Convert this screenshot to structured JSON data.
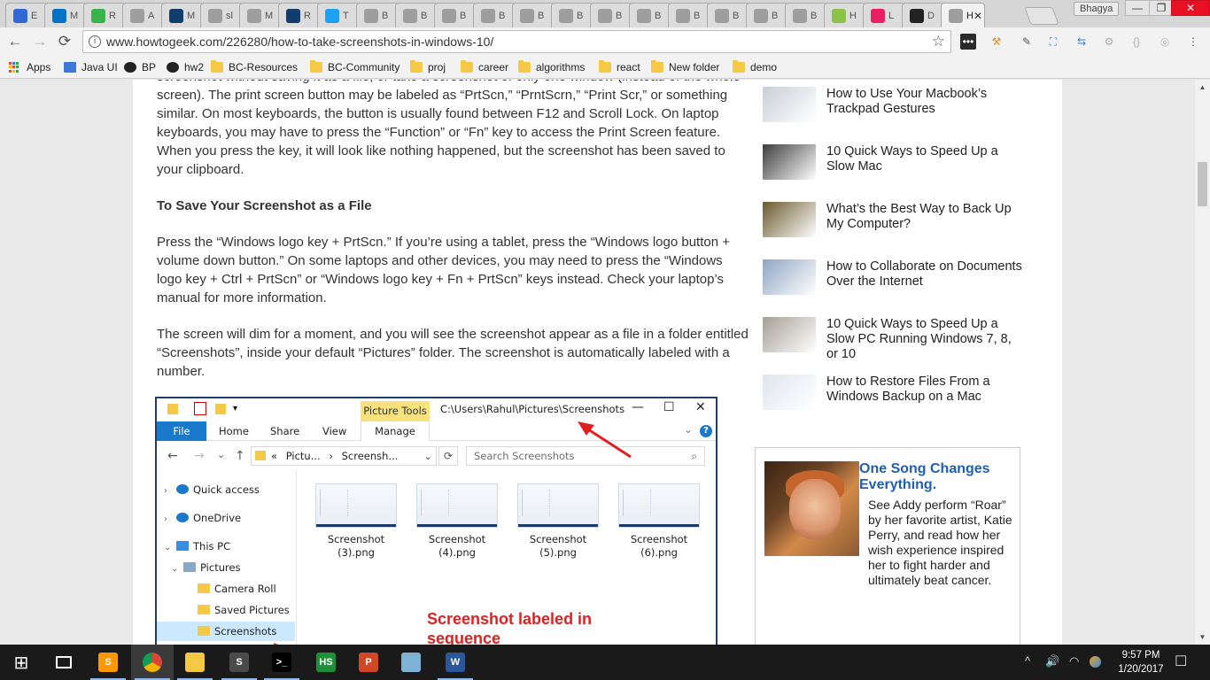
{
  "browser": {
    "tabs": [
      {
        "title": "E",
        "color": "#3367d6"
      },
      {
        "title": "M",
        "color": "#0072c6"
      },
      {
        "title": "R",
        "color": "#3ab44a"
      },
      {
        "title": "A",
        "color": "#9e9e9e"
      },
      {
        "title": "M",
        "color": "#123e6e"
      },
      {
        "title": "sl",
        "color": "#9e9e9e"
      },
      {
        "title": "M",
        "color": "#9e9e9e"
      },
      {
        "title": "R",
        "color": "#123e6e"
      },
      {
        "title": "T",
        "color": "#1da1f2"
      },
      {
        "title": "B",
        "color": "#9e9e9e"
      },
      {
        "title": "B",
        "color": "#9e9e9e"
      },
      {
        "title": "B",
        "color": "#9e9e9e"
      },
      {
        "title": "B",
        "color": "#9e9e9e"
      },
      {
        "title": "B",
        "color": "#9e9e9e"
      },
      {
        "title": "B",
        "color": "#9e9e9e"
      },
      {
        "title": "B",
        "color": "#9e9e9e"
      },
      {
        "title": "B",
        "color": "#9e9e9e"
      },
      {
        "title": "B",
        "color": "#9e9e9e"
      },
      {
        "title": "B",
        "color": "#9e9e9e"
      },
      {
        "title": "B",
        "color": "#9e9e9e"
      },
      {
        "title": "B",
        "color": "#9e9e9e"
      },
      {
        "title": "H",
        "color": "#8bc34a"
      },
      {
        "title": "L",
        "color": "#e91e63"
      },
      {
        "title": "D",
        "color": "#222222"
      },
      {
        "title": "H",
        "color": "#9e9e9e",
        "active": true
      }
    ],
    "close_glyph": "✕",
    "profile_name": "Bhagya",
    "window_controls": {
      "minimize": "—",
      "maximize": "❐",
      "close": "✕"
    },
    "nav": {
      "back": "←",
      "forward": "→",
      "reload": "⟳"
    },
    "url": "www.howtogeek.com/226280/how-to-take-screenshots-in-windows-10/",
    "info_glyph": "i",
    "star_glyph": "☆",
    "bookmarks": [
      {
        "label": "Apps",
        "icon": "apps-icon"
      },
      {
        "label": "Java UI",
        "icon": "doc-icon"
      },
      {
        "label": "BP",
        "icon": "github-icon"
      },
      {
        "label": "hw2",
        "icon": "github-icon"
      },
      {
        "label": "BC-Resources",
        "icon": "folder-icon"
      },
      {
        "label": "BC-Community",
        "icon": "folder-icon"
      },
      {
        "label": "proj",
        "icon": "folder-icon"
      },
      {
        "label": "career",
        "icon": "folder-icon"
      },
      {
        "label": "algorithms",
        "icon": "folder-icon"
      },
      {
        "label": "react",
        "icon": "folder-icon"
      },
      {
        "label": "New folder",
        "icon": "folder-icon"
      },
      {
        "label": "demo",
        "icon": "folder-icon"
      }
    ]
  },
  "article": {
    "para1": "screenshot without saving it as a file, or take a screenshot of only one window (instead of the whole screen). The print screen button may be labeled as “PrtScn,” “PrntScrn,” “Print Scr,” or something similar. On most keyboards, the button is usually found between F12 and Scroll Lock. On laptop keyboards, you may have to press the “Function” or “Fn” key to access the Print Screen feature. When you press the key, it will look like nothing happened, but the screenshot has been saved to your clipboard.",
    "heading": "To Save Your Screenshot as a File",
    "para2": "Press the “Windows logo key + PrtScn.” If you’re using a tablet, press the “Windows logo button + volume down button.” On some laptops and other devices, you may need to press the “Windows logo key + Ctrl + PrtScn” or “Windows logo key + Fn + PrtScn” keys instead. Check your laptop’s manual for more information.",
    "para3": "The screen will dim for a moment, and you will see the screenshot appear as a file in a folder entitled “Screenshots”, inside your default “Pictures” folder. The screenshot is automatically labeled with a number."
  },
  "explorer": {
    "picture_tools": "Picture Tools",
    "title_path": "C:\\Users\\Rahul\\Pictures\\Screenshots",
    "controls": {
      "minimize": "—",
      "maximize": "☐",
      "close": "✕"
    },
    "ribbon_tabs": [
      "File",
      "Home",
      "Share",
      "View",
      "Manage"
    ],
    "collapse_glyph": "⌄",
    "help_glyph": "?",
    "nav": {
      "back": "←",
      "forward": "→",
      "recent": "⌄",
      "up": "↑"
    },
    "address": {
      "prefix": "«",
      "part1": "Pictu...",
      "sep": "›",
      "part2": "Screensh...",
      "dropdown": "⌄",
      "refresh": "⟳"
    },
    "search_placeholder": "Search Screenshots",
    "search_glyph": "⌕",
    "nav_items": [
      {
        "label": "Quick access",
        "chevron": "›",
        "icon": "star-icon",
        "color": "#1979ca"
      },
      {
        "label": "OneDrive",
        "chevron": "›",
        "icon": "cloud-icon",
        "color": "#1979ca"
      },
      {
        "label": "This PC",
        "chevron": "⌄",
        "icon": "computer-icon",
        "color": "#3a8ee0"
      },
      {
        "label": "Pictures",
        "chevron": "⌄",
        "icon": "pictures-icon",
        "color": "#8aa9c9"
      },
      {
        "label": "Camera Roll",
        "chevron": "",
        "icon": "folder-icon",
        "color": "#f5c945"
      },
      {
        "label": "Saved Pictures",
        "chevron": "",
        "icon": "folder-icon",
        "color": "#f5c945"
      },
      {
        "label": "Screenshots",
        "chevron": "",
        "icon": "folder-icon",
        "color": "#f5c945",
        "selected": true
      }
    ],
    "files": [
      {
        "line1": "Screenshot",
        "line2": "(3).png"
      },
      {
        "line1": "Screenshot",
        "line2": "(4).png"
      },
      {
        "line1": "Screenshot",
        "line2": "(5).png"
      },
      {
        "line1": "Screenshot",
        "line2": "(6).png"
      }
    ],
    "annotation": "Screenshot labeled in sequence"
  },
  "sidebar": {
    "related": [
      {
        "title": "How to Use Your Macbook’s Trackpad Gestures",
        "thumb": "#c9cfd6"
      },
      {
        "title": "10 Quick Ways to Speed Up a Slow Mac",
        "thumb": "#3d3d3d"
      },
      {
        "title": "What’s the Best Way to Back Up My Computer?",
        "thumb": "#6b5a2e"
      },
      {
        "title": "How to Collaborate on Documents Over the Internet",
        "thumb": "#8fa6c2"
      },
      {
        "title": "10 Quick Ways to Speed Up a Slow PC Running Windows 7, 8, or 10",
        "thumb": "#a59f95"
      },
      {
        "title": "How to Restore Files From a Windows Backup on a Mac",
        "thumb": "#dfe6ee"
      }
    ],
    "ad": {
      "title": "One Song Changes Everything.",
      "body": "See Addy perform “Roar” by her favorite artist, Katie Perry, and read how her wish experience inspired her to fight harder and ultimately beat cancer."
    }
  },
  "scrollbar": {
    "up": "▲",
    "down": "▼"
  },
  "taskbar": {
    "apps": [
      {
        "name": "task-view",
        "label": ""
      },
      {
        "name": "sublime",
        "label": "S",
        "color": "#ff9800"
      },
      {
        "name": "chrome",
        "label": "",
        "color": "#db4437"
      },
      {
        "name": "file-explorer",
        "label": "",
        "color": "#f5c945"
      },
      {
        "name": "sublime-text",
        "label": "S",
        "color": "#4a4a4a"
      },
      {
        "name": "terminal",
        "label": ">_",
        "color": "#000000"
      },
      {
        "name": "hotspot",
        "label": "HS",
        "color": "#1f8f3a"
      },
      {
        "name": "powerpoint",
        "label": "P",
        "color": "#d24726"
      },
      {
        "name": "app-ice",
        "label": "",
        "color": "#7fb3d5"
      },
      {
        "name": "word",
        "label": "W",
        "color": "#2b579a"
      }
    ],
    "start_glyph": "⊞",
    "tray": {
      "chevron": "^",
      "volume": "🔊",
      "wifi": "◠"
    },
    "time": "9:57 PM",
    "date": "1/20/2017",
    "notification_glyph": "☐"
  }
}
